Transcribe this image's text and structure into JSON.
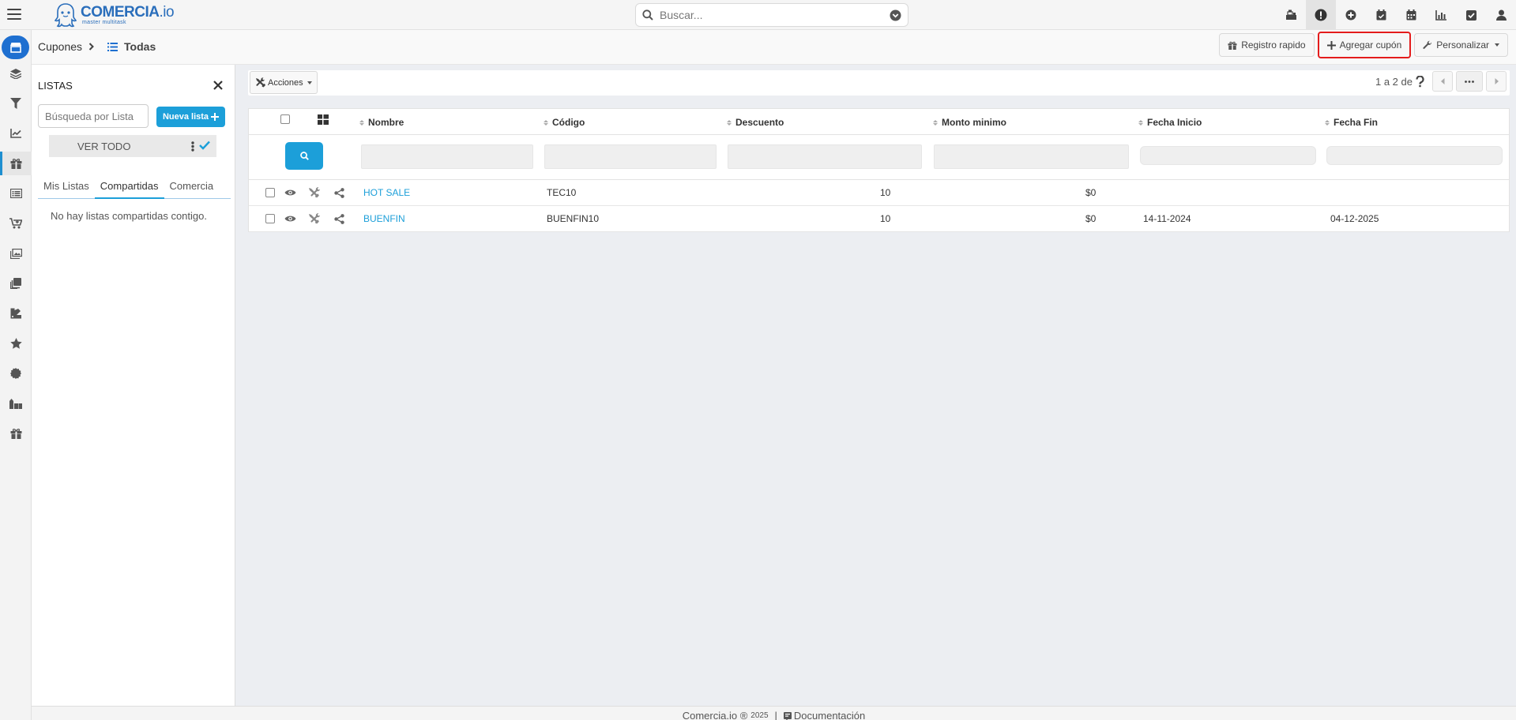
{
  "app": {
    "logo_name": "COMERCIA",
    "logo_ext": ".io",
    "logo_tagline": "master multitask"
  },
  "search": {
    "placeholder": "Buscar..."
  },
  "top_icons": [
    "cash-register-icon",
    "alert-circle-icon",
    "plus-circle-icon",
    "calendar-check-icon",
    "calendar-icon",
    "chart-bar-icon",
    "checkbox-icon",
    "user-icon"
  ],
  "breadcrumb": {
    "parent": "Cupones",
    "current": "Todas"
  },
  "header_buttons": {
    "registro": "Registro rapido",
    "agregar": "Agregar cupón",
    "personalizar": "Personalizar"
  },
  "lists_panel": {
    "title": "LISTAS",
    "search_placeholder": "Búsqueda por Lista",
    "new_list": "Nueva lista",
    "ver_todo": "VER TODO",
    "tabs": [
      "Mis Listas",
      "Compartidas",
      "Comercia"
    ],
    "active_tab": "Compartidas",
    "empty_message": "No hay listas compartidas contigo."
  },
  "toolbar": {
    "acciones": "Acciones",
    "pager_text": "1 a 2  de"
  },
  "table": {
    "columns": [
      "Nombre",
      "Código",
      "Descuento",
      "Monto minimo",
      "Fecha Inicio",
      "Fecha Fin"
    ],
    "rows": [
      {
        "nombre": "HOT SALE",
        "codigo": "TEC10",
        "descuento": "10",
        "monto": "$0",
        "inicio": "",
        "fin": ""
      },
      {
        "nombre": "BUENFIN",
        "codigo": "BUENFIN10",
        "descuento": "10",
        "monto": "$0",
        "inicio": "14-11-2024",
        "fin": "04-12-2025"
      }
    ]
  },
  "footer": {
    "brand": "Comercia.io ®",
    "year": "2025",
    "separator": "|",
    "docs": "Documentación"
  },
  "colors": {
    "primary": "#1c9fd9",
    "brand": "#2a6ebb",
    "highlight_border": "#e41c1c"
  }
}
